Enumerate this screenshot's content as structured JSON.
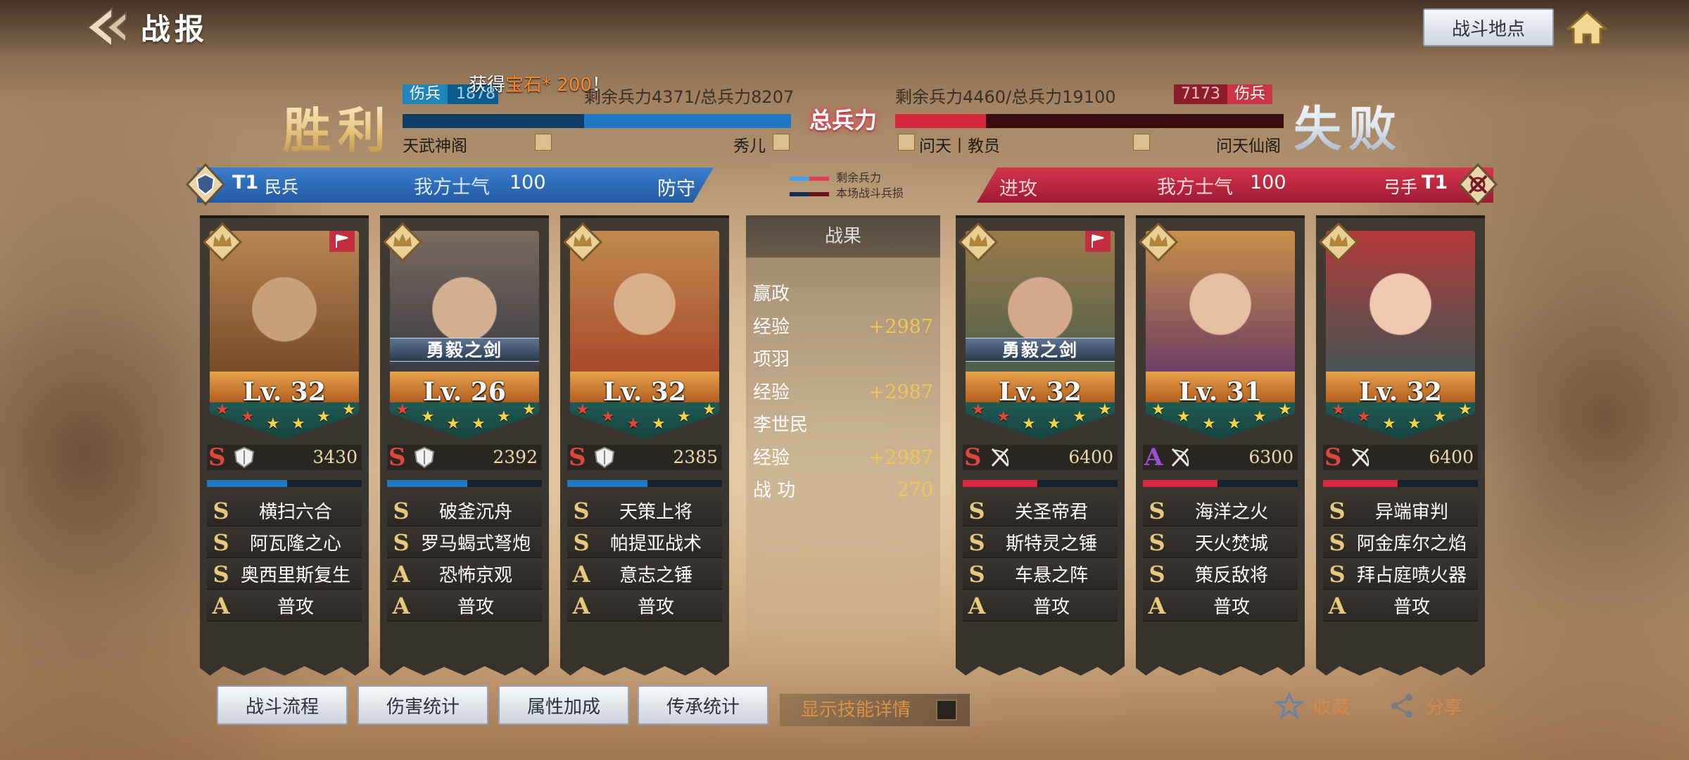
{
  "header": {
    "title": "战报",
    "location_button": "战斗地点",
    "notice_prefix": "获得",
    "notice_highlight": "宝石* 200",
    "notice_suffix": "！"
  },
  "battle": {
    "result_left": "胜利",
    "result_right": "失败",
    "total_label": "总兵力",
    "left": {
      "wounded_label": "伤兵",
      "wounded_value": "1878",
      "remaining_text": "剩余兵力4371/总兵力8207",
      "remaining": 4371,
      "total": 8207,
      "alliance": "天武神阁",
      "player": "秀儿",
      "troop_type": "民兵",
      "tier": "T1",
      "morale_label": "我方士气",
      "morale_value": "100",
      "stance": "防守"
    },
    "right": {
      "wounded_label": "伤兵",
      "wounded_value": "7173",
      "remaining_text": "剩余兵力4460/总兵力19100",
      "remaining": 4460,
      "total": 19100,
      "alliance": "问天仙阁",
      "player": "问天丨教员",
      "troop_type": "弓手",
      "tier": "T1",
      "morale_label": "我方士气",
      "morale_value": "100",
      "stance": "进攻"
    },
    "legend": [
      "剩余兵力",
      "本场战斗兵损"
    ]
  },
  "heroes": [
    {
      "level": "Lv. 32",
      "equip": "",
      "grade": "S",
      "power": "3430",
      "stars_red": 2,
      "troop": "shield",
      "skills": [
        {
          "g": "S",
          "n": "横扫六合"
        },
        {
          "g": "S",
          "n": "阿瓦隆之心"
        },
        {
          "g": "S",
          "n": "奥西里斯复生"
        },
        {
          "g": "A",
          "n": "普攻"
        }
      ]
    },
    {
      "level": "Lv. 26",
      "equip": "勇毅之剑",
      "grade": "S",
      "power": "2392",
      "stars_red": 1,
      "troop": "shield",
      "skills": [
        {
          "g": "S",
          "n": "破釜沉舟"
        },
        {
          "g": "S",
          "n": "罗马蝎式弩炮"
        },
        {
          "g": "A",
          "n": "恐怖京观"
        },
        {
          "g": "A",
          "n": "普攻"
        }
      ]
    },
    {
      "level": "Lv. 32",
      "equip": "",
      "grade": "S",
      "power": "2385",
      "stars_red": 3,
      "troop": "shield",
      "skills": [
        {
          "g": "S",
          "n": "天策上将"
        },
        {
          "g": "S",
          "n": "帕提亚战术"
        },
        {
          "g": "A",
          "n": "意志之锤"
        },
        {
          "g": "A",
          "n": "普攻"
        }
      ]
    },
    {
      "level": "Lv. 32",
      "equip": "勇毅之剑",
      "grade": "S",
      "power": "6400",
      "stars_red": 2,
      "troop": "bow",
      "skills": [
        {
          "g": "S",
          "n": "关圣帝君"
        },
        {
          "g": "S",
          "n": "斯特灵之锤"
        },
        {
          "g": "S",
          "n": "车悬之阵"
        },
        {
          "g": "A",
          "n": "普攻"
        }
      ]
    },
    {
      "level": "Lv. 31",
      "equip": "",
      "grade": "A",
      "power": "6300",
      "stars_red": 0,
      "troop": "bow",
      "skills": [
        {
          "g": "S",
          "n": "海洋之火"
        },
        {
          "g": "S",
          "n": "天火焚城"
        },
        {
          "g": "S",
          "n": "策反敌将"
        },
        {
          "g": "A",
          "n": "普攻"
        }
      ]
    },
    {
      "level": "Lv. 32",
      "equip": "",
      "grade": "S",
      "power": "6400",
      "stars_red": 2,
      "troop": "bow",
      "skills": [
        {
          "g": "S",
          "n": "异端审判"
        },
        {
          "g": "S",
          "n": "阿金库尔之焰"
        },
        {
          "g": "S",
          "n": "拜占庭喷火器"
        },
        {
          "g": "A",
          "n": "普攻"
        }
      ]
    }
  ],
  "results": {
    "title": "战果",
    "rows": [
      {
        "label": "赢政",
        "value": ""
      },
      {
        "label": "经验",
        "value": "+2987"
      },
      {
        "label": "项羽",
        "value": ""
      },
      {
        "label": "经验",
        "value": "+2987"
      },
      {
        "label": "李世民",
        "value": ""
      },
      {
        "label": "经验",
        "value": "+2987"
      },
      {
        "label": "战 功",
        "value": "270"
      }
    ]
  },
  "bottom": {
    "buttons": [
      "战斗流程",
      "伤害统计",
      "属性加成",
      "传承统计"
    ],
    "toggle_label": "显示技能详情",
    "favorite": "收藏",
    "share": "分享"
  },
  "colors": {
    "blue": "#1f78c2",
    "red": "#d6293e",
    "gold": "#f0c55a",
    "grade_s": "#e0463a",
    "grade_a": "#9a4fd0"
  },
  "icons": [
    "back-arrow-icon",
    "home-icon",
    "shield-icon",
    "bow-icon",
    "crown-icon",
    "flag-icon",
    "star-icon",
    "share-icon"
  ]
}
